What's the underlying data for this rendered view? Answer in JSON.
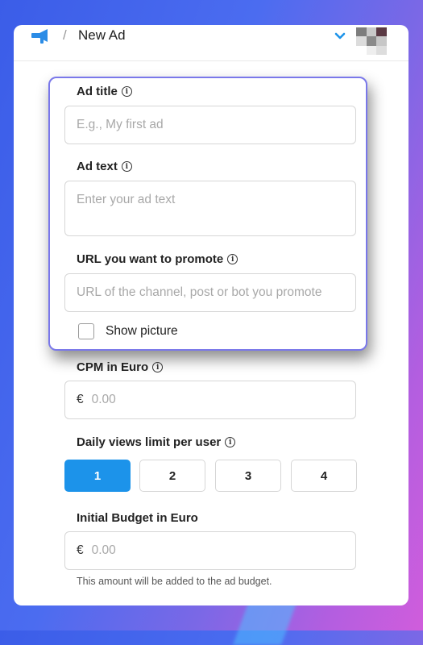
{
  "header": {
    "title": "New Ad",
    "separator": "/"
  },
  "form": {
    "ad_title": {
      "label": "Ad title",
      "placeholder": "E.g., My first ad"
    },
    "ad_text": {
      "label": "Ad text",
      "placeholder": "Enter your ad text"
    },
    "url": {
      "label": "URL you want to promote",
      "placeholder": "URL of the channel, post or bot you promote"
    },
    "show_picture": {
      "label": "Show picture",
      "checked": false
    },
    "cpm": {
      "label": "CPM in Euro",
      "currency": "€",
      "placeholder": "0.00"
    },
    "daily_views": {
      "label": "Daily views limit per user",
      "options": [
        "1",
        "2",
        "3",
        "4"
      ],
      "selected": "1"
    },
    "budget": {
      "label": "Initial Budget in Euro",
      "currency": "€",
      "placeholder": "0.00",
      "hint": "This amount will be added to the ad budget."
    }
  },
  "colors": {
    "accent": "#1c93ea",
    "highlight_border": "#7a78ea",
    "logo": "#2b8ce6"
  },
  "icons": {
    "logo": "megaphone-icon",
    "account_menu": "chevron-down-icon",
    "info": "info-icon"
  }
}
